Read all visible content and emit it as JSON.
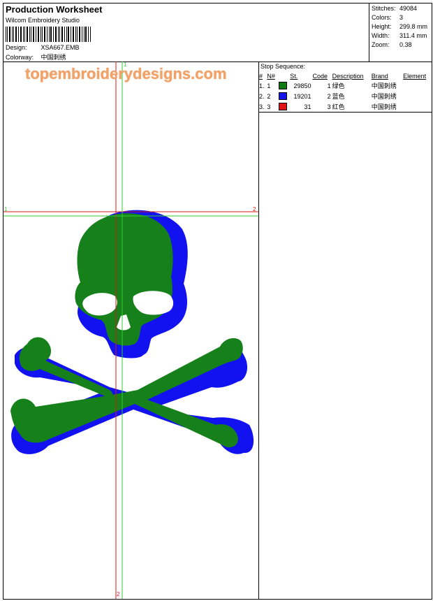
{
  "header": {
    "title": "Production Worksheet",
    "software": "Wilcom Embroidery Studio",
    "design_label": "Design:",
    "design_value": "XSA667.EMB",
    "colorway_label": "Colorway:",
    "colorway_value": "中国刺绣"
  },
  "stats": {
    "stitches_label": "Stitches:",
    "stitches_value": "49084",
    "colors_label": "Colors:",
    "colors_value": "3",
    "height_label": "Height:",
    "height_value": "299.8 mm",
    "width_label": "Width:",
    "width_value": "311.4 mm",
    "zoom_label": "Zoom:",
    "zoom_value": "0.38"
  },
  "watermark": "topembroiderydesigns.com",
  "markers": {
    "left": "1",
    "right": "2",
    "top": "1",
    "bottom": "2"
  },
  "stop_sequence": {
    "title": "Stop Sequence:",
    "columns": {
      "index": "#",
      "n": "N#",
      "stitches": "St.",
      "code": "Code",
      "description": "Description",
      "brand": "Brand",
      "element": "Element"
    },
    "rows": [
      {
        "index": "1.",
        "n": "1",
        "color": "#0f7a12",
        "stitches": "29850",
        "code": "1",
        "description": "绿色",
        "brand": "中国刺绣",
        "element": ""
      },
      {
        "index": "2.",
        "n": "2",
        "color": "#1414e8",
        "stitches": "19201",
        "code": "2",
        "description": "蓝色",
        "brand": "中国刺绣",
        "element": ""
      },
      {
        "index": "3.",
        "n": "3",
        "color": "#e01414",
        "stitches": "31",
        "code": "3",
        "description": "红色",
        "brand": "中国刺绣",
        "element": ""
      }
    ]
  },
  "design_colors": {
    "green": "#16801a",
    "blue": "#1212f0",
    "red": "#d81818",
    "guide_green": "#33cc33"
  }
}
